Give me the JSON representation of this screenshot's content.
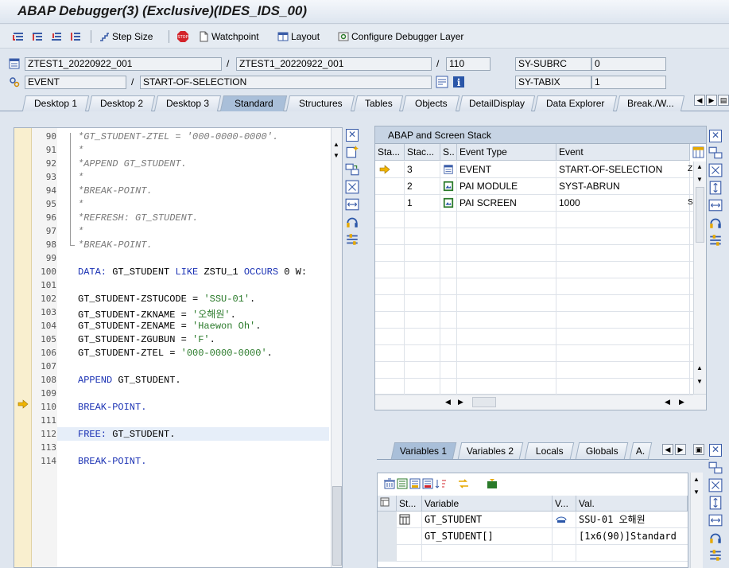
{
  "window": {
    "title": "ABAP Debugger(3)  (Exclusive)(IDES_IDS_00)"
  },
  "toolbar": {
    "step_size": "Step Size",
    "watchpoint": "Watchpoint",
    "layout": "Layout",
    "configure": "Configure Debugger Layer"
  },
  "info": {
    "program": "ZTEST1_20220922_001",
    "include": "ZTEST1_20220922_001",
    "line": "110",
    "subrc_label": "SY-SUBRC",
    "subrc": "0",
    "event_type": "EVENT",
    "event": "START-OF-SELECTION",
    "tabix_label": "SY-TABIX",
    "tabix": "1",
    "slash1": "/",
    "slash2": "/",
    "slash3": "/"
  },
  "tabs": [
    "Desktop 1",
    "Desktop 2",
    "Desktop 3",
    "Standard",
    "Structures",
    "Tables",
    "Objects",
    "DetailDisplay",
    "Data Explorer",
    "Break./W..."
  ],
  "code": {
    "line_numbers": [
      "90",
      "91",
      "92",
      "93",
      "94",
      "95",
      "96",
      "97",
      "98",
      "99",
      "100",
      "101",
      "102",
      "103",
      "104",
      "105",
      "106",
      "107",
      "108",
      "109",
      "110",
      "111",
      "112",
      "113",
      "114"
    ],
    "l90": "*GT_STUDENT-ZTEL = '000-0000-0000'.",
    "l91": "*",
    "l92": "*APPEND GT_STUDENT.",
    "l93": "*",
    "l94": "*BREAK-POINT.",
    "l95": "*",
    "l96": "*REFRESH: GT_STUDENT.",
    "l97": "*",
    "l98": "*BREAK-POINT.",
    "l100a": "DATA:",
    "l100b": " GT_STUDENT ",
    "l100c": "LIKE",
    "l100d": " ZSTU_1 ",
    "l100e": "OCCURS",
    "l100f": " 0 W:",
    "l102a": "GT_STUDENT-ZSTUCODE = ",
    "l102b": "'SSU-01'",
    "l103a": "GT_STUDENT-ZKNAME = ",
    "l103b": "'오해원'",
    "l104a": "GT_STUDENT-ZENAME = ",
    "l104b": "'Haewon Oh'",
    "l105a": "GT_STUDENT-ZGUBUN = ",
    "l105b": "'F'",
    "l106a": "GT_STUDENT-ZTEL = ",
    "l106b": "'000-0000-0000'",
    "dot": ".",
    "l108a": "APPEND",
    "l108b": " GT_STUDENT.",
    "l110": "BREAK-POINT.",
    "l112a": "FREE:",
    "l112b": " GT_STUDENT.",
    "l114": "BREAK-POINT."
  },
  "stack": {
    "title": "ABAP and Screen Stack",
    "headers": [
      "Sta...",
      "Stac...",
      "S..",
      "Event Type",
      "Event"
    ],
    "rows": [
      {
        "level": "3",
        "type": "EVENT",
        "event": "START-OF-SELECTION",
        "extra": "Z"
      },
      {
        "level": "2",
        "type": "PAI MODULE",
        "event": "SYST-ABRUN",
        "extra": ""
      },
      {
        "level": "1",
        "type": "PAI SCREEN",
        "event": "1000",
        "extra": "S"
      }
    ]
  },
  "vars": {
    "tabs": [
      "Variables 1",
      "Variables 2",
      "Locals",
      "Globals",
      "A."
    ],
    "headers": [
      "St...",
      "Variable",
      "V...",
      "Val."
    ],
    "rows": [
      {
        "name": "GT_STUDENT",
        "value": "SSU-01      오해원"
      },
      {
        "name": "GT_STUDENT[]",
        "value": "[1x6(90)]Standard"
      }
    ]
  }
}
